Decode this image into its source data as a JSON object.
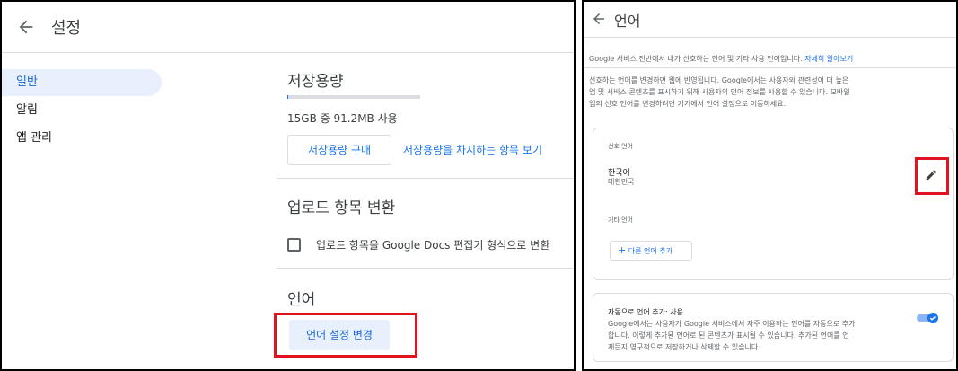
{
  "left": {
    "header_title": "설정",
    "nav": [
      {
        "label": "일반",
        "active": true
      },
      {
        "label": "알림",
        "active": false
      },
      {
        "label": "앱 관리",
        "active": false
      }
    ],
    "storage": {
      "title": "저장용량",
      "usage_text": "15GB 중 91.2MB 사용",
      "usage_fraction": 0.006,
      "buy_button": "저장용량 구매",
      "view_link": "저장용량을 차지하는 항목 보기"
    },
    "convert": {
      "title": "업로드 항목 변환",
      "checkbox_label": "업로드 항목을 Google Docs 편집기 형식으로 변환",
      "checked": false
    },
    "language": {
      "title": "언어",
      "button": "언어 설정 변경"
    }
  },
  "right": {
    "header_title": "언어",
    "intro": "Google 서비스 전반에서 내가 선호하는 언어 및 기타 사용 언어입니다.",
    "learn_more": "자세히 알아보기",
    "desc_line1": "선호하는 언어를 변경하면 웹에 반영됩니다. Google에서는 사용자와 관련성이 더 높은",
    "desc_line2": "앱 및 서비스 콘텐츠를 표시하기 위해 사용자의 언어 정보를 사용할 수 있습니다. 모바일",
    "desc_line3": "앱의 선호 언어를 변경하려면 기기에서 언어 설정으로 이동하세요.",
    "preferred_label": "선호 언어",
    "preferred_lang": "한국어",
    "preferred_region": "대한민국",
    "other_label": "기타 언어",
    "add_button": "다른 언어 추가",
    "auto_title": "자동으로 언어 추가: 사용",
    "auto_line1": "Google에서는 사용자가 Google 서비스에서 자주 이용하는 언어를 자동으로 추가",
    "auto_line2": "합니다. 이렇게 추가된 언어로 된 콘텐츠가 표시될 수 있습니다. 추가된 언어를 언",
    "auto_line3": "제든지 영구적으로 저장하거나 삭제할 수 있습니다.",
    "auto_enabled": true
  },
  "colors": {
    "accent": "#1a73e8",
    "highlight_box": "#e0141e"
  }
}
